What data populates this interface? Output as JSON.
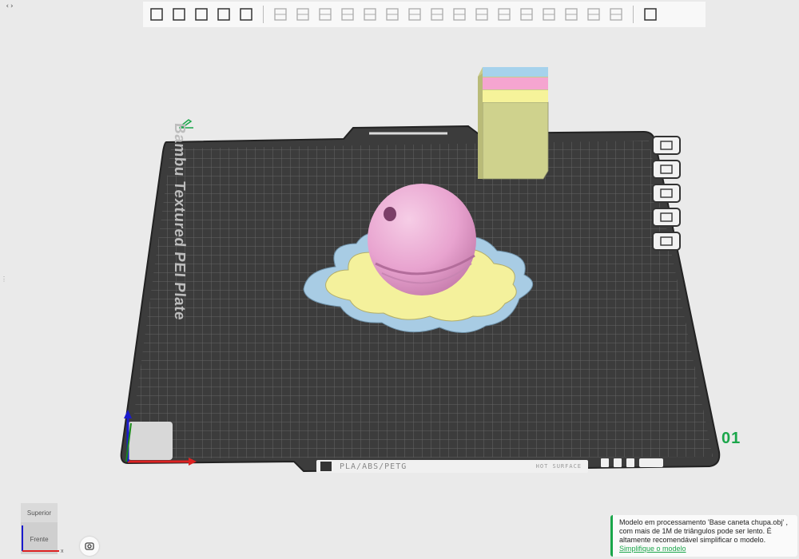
{
  "toolbar": {
    "groups": [
      [
        "add-part-icon",
        "add-plate-icon",
        "auto-orient-icon",
        "arrange-icon",
        "slice-layers-icon"
      ],
      [
        "move-icon",
        "rotate-icon",
        "scale-icon",
        "lay-on-face-icon",
        "cut-icon",
        "boolean-icon",
        "support-paint-icon",
        "color-paint-icon",
        "text-icon",
        "seam-icon",
        "measure-icon",
        "assemble-icon",
        "brim-icon",
        "variable-layer-icon",
        "modifier-icon",
        "ruler-icon"
      ],
      [
        "split-view-icon"
      ]
    ]
  },
  "collapse_label": "‹›",
  "plate": {
    "name_label": "Bambu Textured PEI Plate",
    "number": "01",
    "filament_text": "PLA/ABS/PETG",
    "hot_warning": "HOT SURFACE"
  },
  "side_tools": [
    "close-plate-icon",
    "auto-orient-plate-icon",
    "arrange-plate-icon",
    "lock-plate-icon",
    "plate-settings-icon"
  ],
  "view_cube": {
    "top_label": "Superior",
    "front_label": "Frente"
  },
  "notification": {
    "message": "Modelo em processamento 'Base caneta chupa.obj' , com mais de 1M de triângulos pode ser lento. É altamente recomendável simplificar o modelo.",
    "link": "Simplifique o modelo"
  },
  "colors": {
    "accent": "#1aa64a",
    "bed": "#3c3c3c",
    "flower_blue": "#a8cce4",
    "flower_yellow": "#f4f19c",
    "sphere_pink": "#e8a3cf",
    "tower_pink": "#f5a5d0",
    "tower_blue": "#a6d2ec",
    "tower_yellow": "#f6f39a",
    "tower_side": "#b9bb78"
  }
}
